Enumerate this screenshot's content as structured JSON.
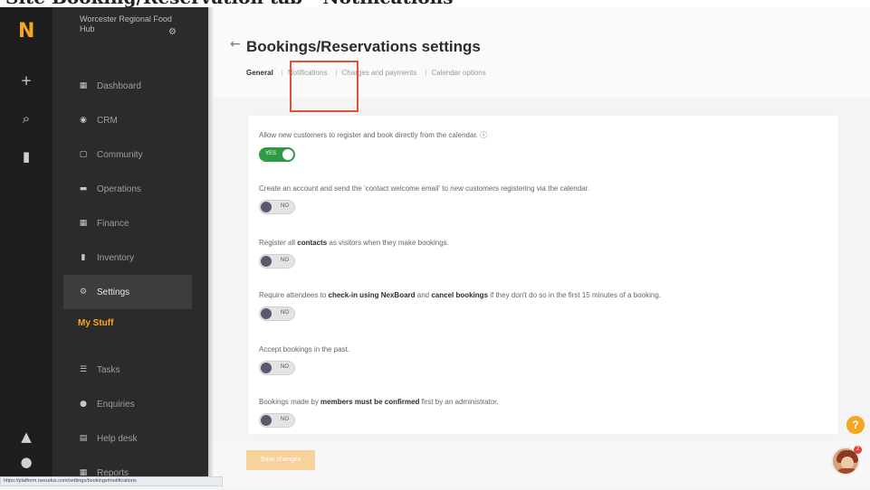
{
  "slide_title": "Site Booking/Reservation tab - Notifications",
  "rail": {
    "logo": "N",
    "icons": [
      "plus-icon",
      "search-icon",
      "bookmark-icon",
      "bell-icon",
      "user-icon"
    ]
  },
  "sidebar": {
    "org_name": "Worcester Regional Food Hub",
    "items": [
      {
        "label": "Dashboard",
        "icon": "dashboard-icon"
      },
      {
        "label": "CRM",
        "icon": "crm-icon"
      },
      {
        "label": "Community",
        "icon": "community-icon"
      },
      {
        "label": "Operations",
        "icon": "operations-icon"
      },
      {
        "label": "Finance",
        "icon": "finance-icon"
      },
      {
        "label": "Inventory",
        "icon": "inventory-icon"
      },
      {
        "label": "Settings",
        "icon": "settings-icon",
        "active": true
      }
    ],
    "section_label": "My Stuff",
    "my_stuff": [
      {
        "label": "Tasks",
        "icon": "tasks-icon"
      },
      {
        "label": "Enquiries",
        "icon": "enquiries-icon"
      },
      {
        "label": "Help desk",
        "icon": "help-desk-icon"
      },
      {
        "label": "Reports",
        "icon": "reports-icon"
      }
    ]
  },
  "page": {
    "back_label": "←",
    "title": "Bookings/Reservations settings",
    "tabs": [
      "General",
      "Notifications",
      "Charges and payments",
      "Calendar options"
    ],
    "active_tab": "General"
  },
  "settings": [
    {
      "parts": [
        "Allow new customers to register and book directly from the calendar. ⓘ"
      ],
      "toggle": "YES"
    },
    {
      "parts": [
        "Create an account and send the 'contact welcome email' to new customers registering via the calendar."
      ],
      "toggle": "NO"
    },
    {
      "parts": [
        "Register all ",
        "contacts",
        " as visitors when they make bookings."
      ],
      "toggle": "NO"
    },
    {
      "parts": [
        "Require attendees to ",
        "check-in using NexBoard",
        " and ",
        "cancel bookings",
        " if they don't do so in the first 15 minutes of a booking."
      ],
      "toggle": "NO"
    },
    {
      "parts": [
        "Accept bookings in the past."
      ],
      "toggle": "NO"
    },
    {
      "parts": [
        "Bookings made by ",
        "members must be confirmed",
        " first by an administrator."
      ],
      "toggle": "NO"
    }
  ],
  "footer": {
    "save_label": "Save changes"
  },
  "help_label": "?",
  "avatar_badge": "2",
  "status_url": "https://platform.nexudus.com/settings/bookings#notifications",
  "colors": {
    "accent": "#f7a823",
    "toggle_on": "#2e9c45",
    "highlight": "#e0503a"
  }
}
